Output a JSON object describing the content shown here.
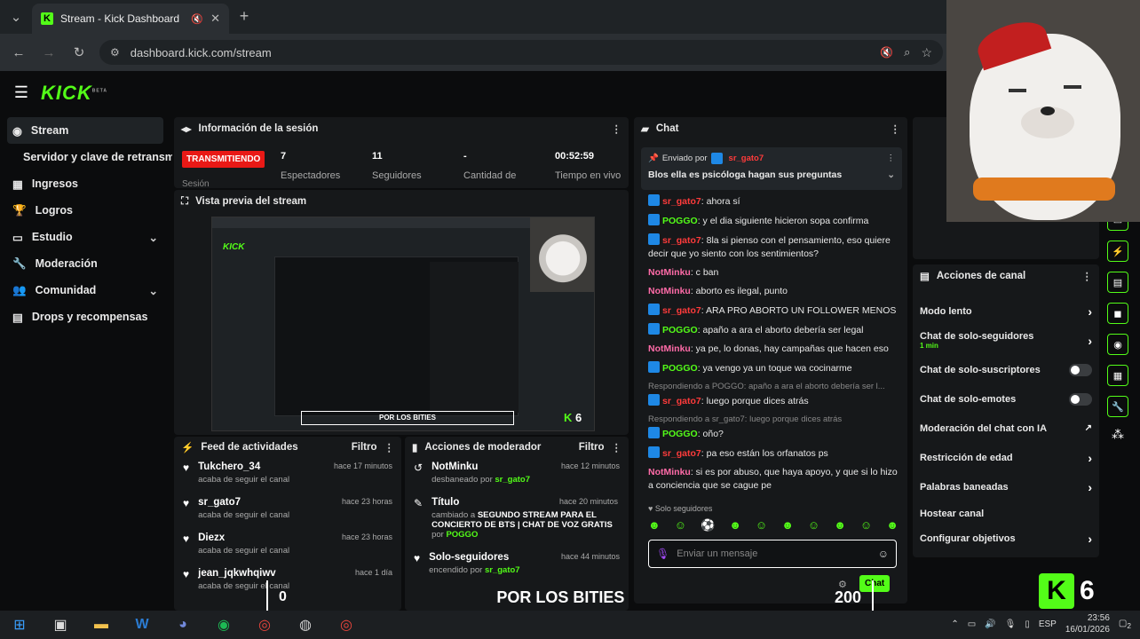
{
  "browser": {
    "tab_title": "Stream - Kick Dashboard",
    "url": "dashboard.kick.com/stream"
  },
  "app": {
    "logo": "KICK",
    "logo_sup": "BETA"
  },
  "sidebar": {
    "items": [
      {
        "label": "Stream"
      },
      {
        "label": "Servidor y clave de retransmisión"
      },
      {
        "label": "Ingresos"
      },
      {
        "label": "Logros"
      },
      {
        "label": "Estudio"
      },
      {
        "label": "Moderación"
      },
      {
        "label": "Comunidad"
      },
      {
        "label": "Drops y recompensas"
      }
    ]
  },
  "session": {
    "title": "Información de la sesión",
    "status": "TRANSMITIENDO",
    "status_sub": "Sesión",
    "stats": [
      {
        "value": "7",
        "label": "Espectadores"
      },
      {
        "value": "11",
        "label": "Seguidores"
      },
      {
        "value": "-",
        "label": "Cantidad de"
      },
      {
        "value": "00:52:59",
        "label": "Tiempo en vivo"
      }
    ]
  },
  "preview": {
    "title": "Vista previa del stream",
    "overlay_text": "POR LOS BITIES",
    "overlay_left": "0",
    "overlay_right": "200",
    "corner_number": "6"
  },
  "feed": {
    "title": "Feed de actividades",
    "filter": "Filtro",
    "items": [
      {
        "name": "Tukchero_34",
        "desc": "acaba de seguir el canal",
        "time": "hace 17 minutos"
      },
      {
        "name": "sr_gato7",
        "desc": "acaba de seguir el canal",
        "time": "hace 23 horas"
      },
      {
        "name": "Diezx",
        "desc": "acaba de seguir el canal",
        "time": "hace 23 horas"
      },
      {
        "name": "jean_jqkwhqiwv",
        "desc": "acaba de seguir el canal",
        "time": "hace 1 día"
      }
    ]
  },
  "modactions": {
    "title": "Acciones de moderador",
    "filter": "Filtro",
    "items": [
      {
        "name": "NotMinku",
        "desc_pre": "desbaneado por",
        "desc_user": "sr_gato7",
        "time": "hace 12 minutos"
      },
      {
        "name": "Título",
        "desc_pre": "cambiado a",
        "desc_bold": "SEGUNDO STREAM PARA EL CONCIERTO DE BTS | CHAT DE VOZ GRATIS",
        "desc_mid": "por",
        "desc_user": "POGGO",
        "time": "hace 20 minutos"
      },
      {
        "name": "Solo-seguidores",
        "desc_pre": "encendido por",
        "desc_user": "sr_gato7",
        "time": "hace 44 minutos"
      }
    ]
  },
  "chat": {
    "title": "Chat",
    "pinned_by": "Enviado por",
    "pinned_user": "sr_gato7",
    "pinned_msg": "Blos ella es psicóloga hagan sus preguntas",
    "messages": [
      {
        "user": "sr_gato7",
        "cls": "u-red",
        "badge": true,
        "text": ": ahora sí"
      },
      {
        "user": "POGGO",
        "cls": "u-green",
        "badge": true,
        "text": ": y el dia siguiente hicieron sopa confirma"
      },
      {
        "user": "sr_gato7",
        "cls": "u-red",
        "badge": true,
        "text": ": 8la si pienso con el pensamiento, eso quiere decir que yo siento con los sentimientos?"
      },
      {
        "user": "NotMinku",
        "cls": "u-pink",
        "badge": false,
        "text": ": c ban"
      },
      {
        "user": "NotMinku",
        "cls": "u-pink",
        "badge": false,
        "text": ": aborto es ilegal, punto"
      },
      {
        "user": "sr_gato7",
        "cls": "u-red",
        "badge": true,
        "text": ": ARA PRO ABORTO UN FOLLOWER MENOS"
      },
      {
        "user": "POGGO",
        "cls": "u-green",
        "badge": true,
        "text": ": apaño a ara el aborto debería ser legal"
      },
      {
        "user": "NotMinku",
        "cls": "u-pink",
        "badge": false,
        "text": ": ya pe, lo donas, hay campañas que hacen eso"
      },
      {
        "user": "POGGO",
        "cls": "u-green",
        "badge": true,
        "text": ": ya vengo ya un toque wa cocinarme"
      },
      {
        "reply": "Respondiendo a POGGO: apaño a ara el aborto debería ser l...",
        "user": "sr_gato7",
        "cls": "u-red",
        "badge": true,
        "text": ": luego porque dices atrás"
      },
      {
        "reply": "Respondiendo a sr_gato7: luego porque dices atrás",
        "user": "POGGO",
        "cls": "u-green",
        "badge": true,
        "text": ": oño?"
      },
      {
        "user": "sr_gato7",
        "cls": "u-red",
        "badge": true,
        "text": ": pa eso están los orfanatos ps"
      },
      {
        "user": "NotMinku",
        "cls": "u-pink",
        "badge": false,
        "text": ": si es por abuso, que haya apoyo, y que si lo hizo a conciencia que se cague pe"
      }
    ],
    "mode_label": "Solo seguidores",
    "input_placeholder": "Enviar un mensaje",
    "send_label": "Chat"
  },
  "channel_actions": {
    "title": "Acciones de canal",
    "items": [
      {
        "label": "Modo lento",
        "kind": "arrow"
      },
      {
        "label": "Chat de solo-seguidores",
        "sub": "1 min",
        "kind": "arrow"
      },
      {
        "label": "Chat de solo-suscriptores",
        "kind": "toggle"
      },
      {
        "label": "Chat de solo-emotes",
        "kind": "toggle"
      },
      {
        "label": "Moderación del chat con IA",
        "kind": "ext"
      },
      {
        "label": "Restricción de edad",
        "kind": "arrow"
      },
      {
        "label": "Palabras baneadas",
        "kind": "arrow"
      },
      {
        "label": "Hostear canal",
        "kind": "none"
      },
      {
        "label": "Configurar objetivos",
        "kind": "arrow"
      }
    ]
  },
  "taskbar": {
    "lang": "ESP",
    "time": "23:56",
    "date": "16/01/2026",
    "notif": "2"
  },
  "colors": {
    "accent": "#53fc18",
    "live": "#e91916",
    "bg": "#0b0c0d",
    "panel": "#16181a"
  }
}
